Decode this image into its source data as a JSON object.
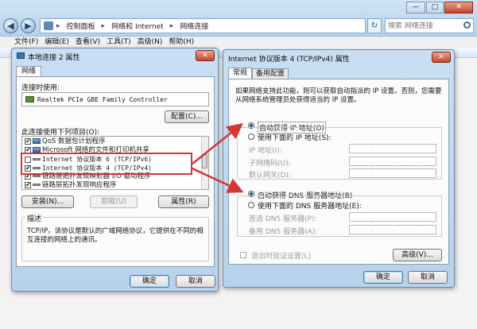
{
  "explorer": {
    "breadcrumbs": [
      "控制面板",
      "网络和 Internet",
      "网络连接"
    ],
    "search_placeholder": "搜索 网络连接",
    "window_controls": [
      "—",
      "□",
      "✕"
    ],
    "menu": [
      "文件(F)",
      "编辑(E)",
      "查看(V)",
      "工具(T)",
      "高级(N)",
      "帮助(H)"
    ]
  },
  "conn_dialog": {
    "title": "本地连接 2 属性",
    "close_glyph": "✕",
    "tab": "网络",
    "connect_using_label": "连接时使用:",
    "adapter": "Realtek PCIe GBE Family Controller",
    "configure_button": "配置(C)...",
    "items_label": "此连接使用下列项目(O):",
    "items": [
      {
        "label": "QoS 数据包计划程序",
        "checked": true
      },
      {
        "label": "Microsoft 网络的文件和打印机共享",
        "checked": true
      },
      {
        "label": "Internet 协议版本 6 (TCP/IPv6)",
        "checked": false
      },
      {
        "label": "Internet 协议版本 4 (TCP/IPv4)",
        "checked": true
      },
      {
        "label": "链路层拓扑发现映射器 I/O 驱动程序",
        "checked": true
      },
      {
        "label": "链路层拓扑发现响应程序",
        "checked": true
      }
    ],
    "install_button": "安装(N)...",
    "uninstall_button": "卸载(U)",
    "properties_button": "属性(R)",
    "description_label": "描述",
    "description_text": "TCP/IP。该协议是默认的广域网络协议，它提供在不同的相互连接的网络上的通讯。",
    "ok_button": "确定",
    "cancel_button": "取消"
  },
  "ipv4_dialog": {
    "title": "Internet 协议版本 4 (TCP/IPv4) 属性",
    "close_glyph": "✕",
    "tabs": [
      "常规",
      "备用配置"
    ],
    "intro": "如果网络支持此功能，则可以获取自动指派的 IP 设置。否则，您需要从网络系统管理员处获得适当的 IP 设置。",
    "auto_ip": "自动获得 IP 地址(O)",
    "manual_ip": "使用下面的 IP 地址(S):",
    "ip_address_label": "IP 地址(I):",
    "subnet_label": "子网掩码(U):",
    "gateway_label": "默认网关(D):",
    "auto_dns": "自动获得 DNS 服务器地址(B)",
    "manual_dns": "使用下面的 DNS 服务器地址(E):",
    "preferred_dns_label": "首选 DNS 服务器(P):",
    "alternate_dns_label": "备用 DNS 服务器(A):",
    "validate_label": "退出时验证设置(L)",
    "advanced_button": "高级(V)...",
    "ok_button": "确定",
    "cancel_button": "取消",
    "ip_dot": "."
  },
  "colors": {
    "highlight_red": "#d83434",
    "title_blue": "#b8d2ec"
  }
}
